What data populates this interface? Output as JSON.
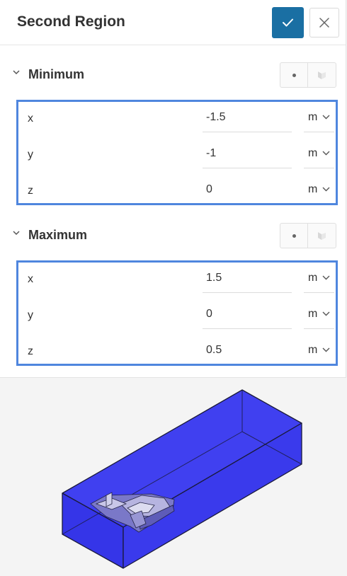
{
  "header": {
    "title": "Second Region"
  },
  "icons": {
    "confirm": "check-icon",
    "close": "close-icon",
    "expand": "chevron-down-icon",
    "unit_dropdown": "chevron-down-icon"
  },
  "colors": {
    "confirm_button": "#1a6fa3",
    "highlight_border": "#4f86de",
    "domain_fill": "#3333ee"
  },
  "minimum": {
    "label": "Minimum",
    "rows": [
      {
        "axis": "x",
        "value": "-1.5",
        "unit": "m"
      },
      {
        "axis": "y",
        "value": "-1",
        "unit": "m"
      },
      {
        "axis": "z",
        "value": "0",
        "unit": "m"
      }
    ]
  },
  "maximum": {
    "label": "Maximum",
    "rows": [
      {
        "axis": "x",
        "value": "1.5",
        "unit": "m"
      },
      {
        "axis": "y",
        "value": "0",
        "unit": "m"
      },
      {
        "axis": "z",
        "value": "0.5",
        "unit": "m"
      }
    ]
  }
}
